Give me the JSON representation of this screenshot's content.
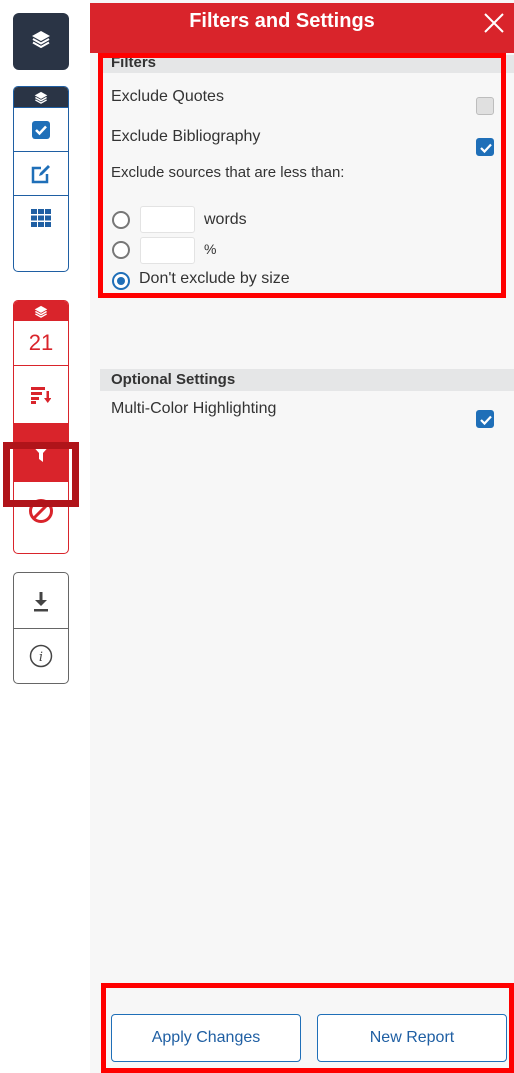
{
  "sidebar": {
    "count_badge": "21",
    "icons": {
      "top": "layers-icon",
      "group1_header": "layers-icon",
      "checkbox": "checkbox-icon",
      "edit": "edit-icon",
      "grid": "grid-icon",
      "group2_header": "layers-icon",
      "sort": "sort-icon",
      "filter": "filter-icon",
      "exclude": "block-icon",
      "download": "download-icon",
      "info": "info-icon"
    }
  },
  "panel": {
    "title": "Filters and Settings",
    "close_icon": "close-icon",
    "filters": {
      "header": "Filters",
      "exclude_quotes": {
        "label": "Exclude Quotes",
        "checked": false
      },
      "exclude_bibliography": {
        "label": "Exclude Bibliography",
        "checked": true
      },
      "size_label": "Exclude sources that are less than:",
      "words_value": "",
      "words_unit": "words",
      "percent_value": "",
      "percent_unit": "%",
      "dont_exclude_label": "Don't exclude by size",
      "selected_option": "dont_exclude"
    },
    "optional": {
      "header": "Optional Settings",
      "multicolor": {
        "label": "Multi-Color Highlighting",
        "checked": true
      }
    },
    "buttons": {
      "apply": "Apply Changes",
      "new_report": "New Report"
    }
  },
  "colors": {
    "accent_red": "#d9242b",
    "accent_blue": "#1f6fb8",
    "dark_navy": "#2a3445",
    "highlight_red": "#ff0000"
  }
}
